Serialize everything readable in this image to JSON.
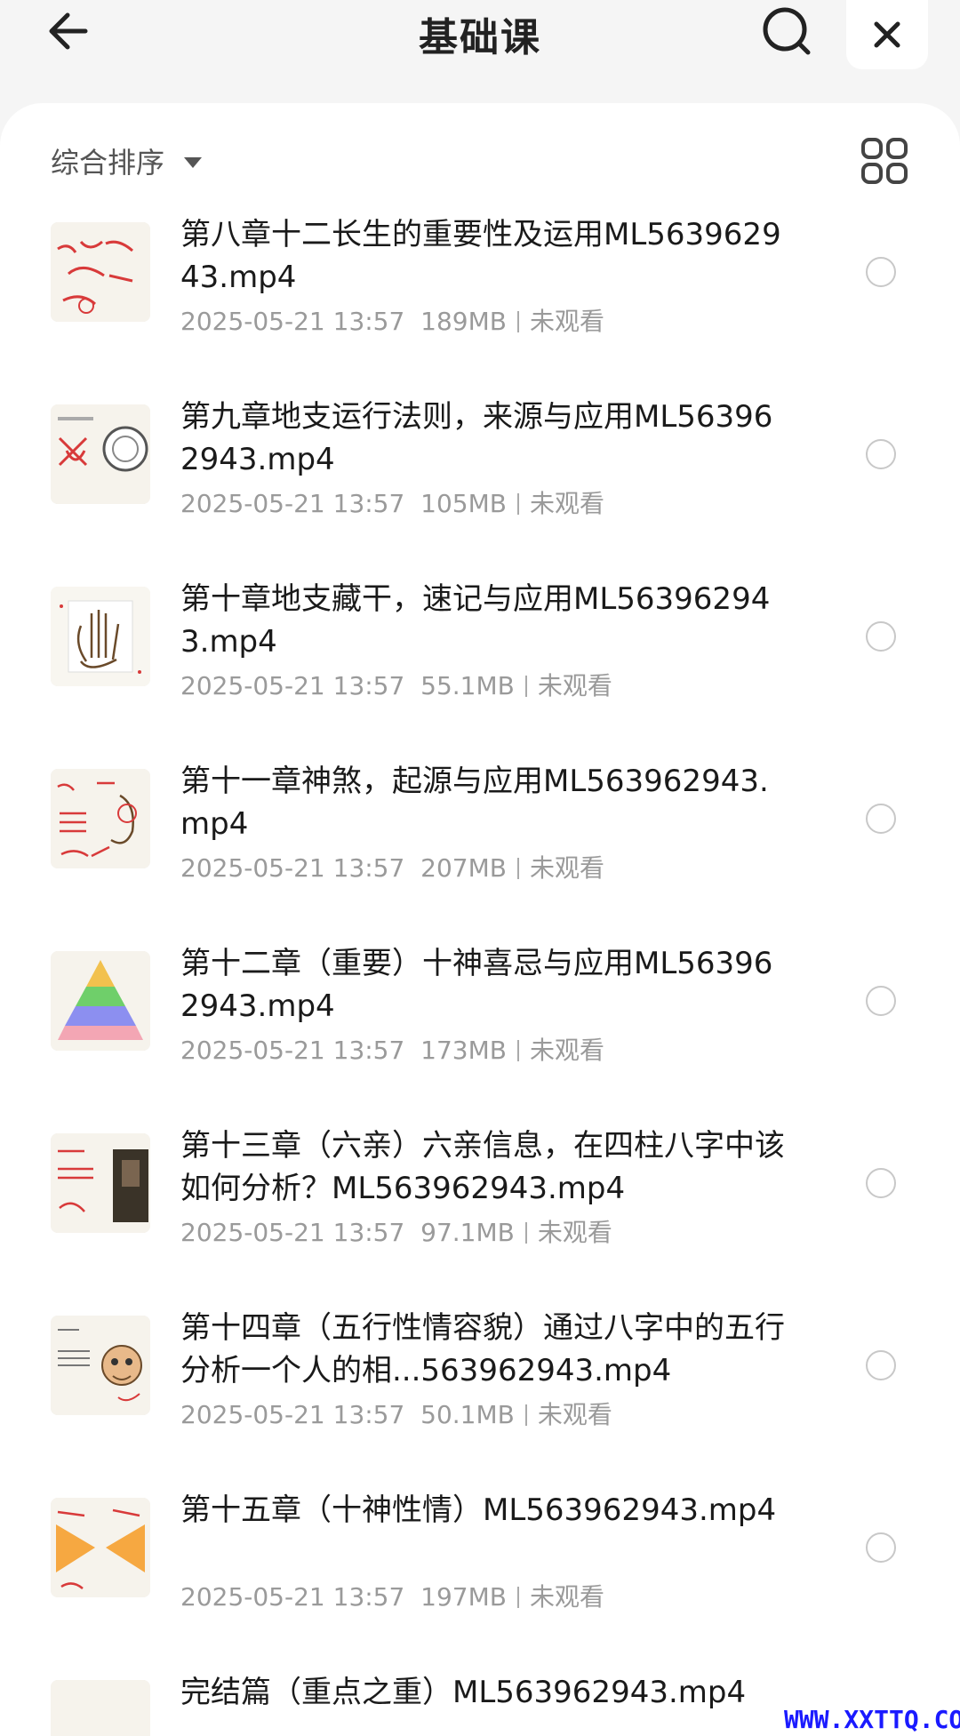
{
  "header": {
    "title": "基础课",
    "back_icon": "arrow-left-icon",
    "search_icon": "search-icon",
    "close_icon": "close-icon"
  },
  "toolbar": {
    "sort_label": "综合排序",
    "sort_icon": "caret-down-icon",
    "view_icon": "grid-view-icon"
  },
  "files": [
    {
      "title": "第八章十二长生的重要性及运用ML563962943.mp4",
      "date": "2025-05-21 13:57",
      "size": "189MB",
      "status": "未观看"
    },
    {
      "title": "第九章地支运行法则，来源与应用ML563962943.mp4",
      "date": "2025-05-21 13:57",
      "size": "105MB",
      "status": "未观看"
    },
    {
      "title": "第十章地支藏干，速记与应用ML563962943.mp4",
      "date": "2025-05-21 13:57",
      "size": "55.1MB",
      "status": "未观看"
    },
    {
      "title": "第十一章神煞，起源与应用ML563962943.mp4",
      "date": "2025-05-21 13:57",
      "size": "207MB",
      "status": "未观看"
    },
    {
      "title": "第十二章（重要）十神喜忌与应用ML563962943.mp4",
      "date": "2025-05-21 13:57",
      "size": "173MB",
      "status": "未观看"
    },
    {
      "title": "第十三章（六亲）六亲信息，在四柱八字中该如何分析？ML563962943.mp4",
      "date": "2025-05-21 13:57",
      "size": "97.1MB",
      "status": "未观看"
    },
    {
      "title": "第十四章（五行性情容貌）通过八字中的五行分析一个人的相...563962943.mp4",
      "date": "2025-05-21 13:57",
      "size": "50.1MB",
      "status": "未观看"
    },
    {
      "title": "第十五章（十神性情）ML563962943.mp4",
      "date": "2025-05-21 13:57",
      "size": "197MB",
      "status": "未观看"
    }
  ],
  "partial_next_title": "完结篇（重点之重）ML563962943.mp4",
  "watermark": "WWW.XXTTQ.COM",
  "colors": {
    "background": "#f5f5f5",
    "panel": "#ffffff",
    "title_text": "#1a1a1a",
    "meta_text": "#9a9a9a",
    "watermark": "#1a1aff"
  }
}
